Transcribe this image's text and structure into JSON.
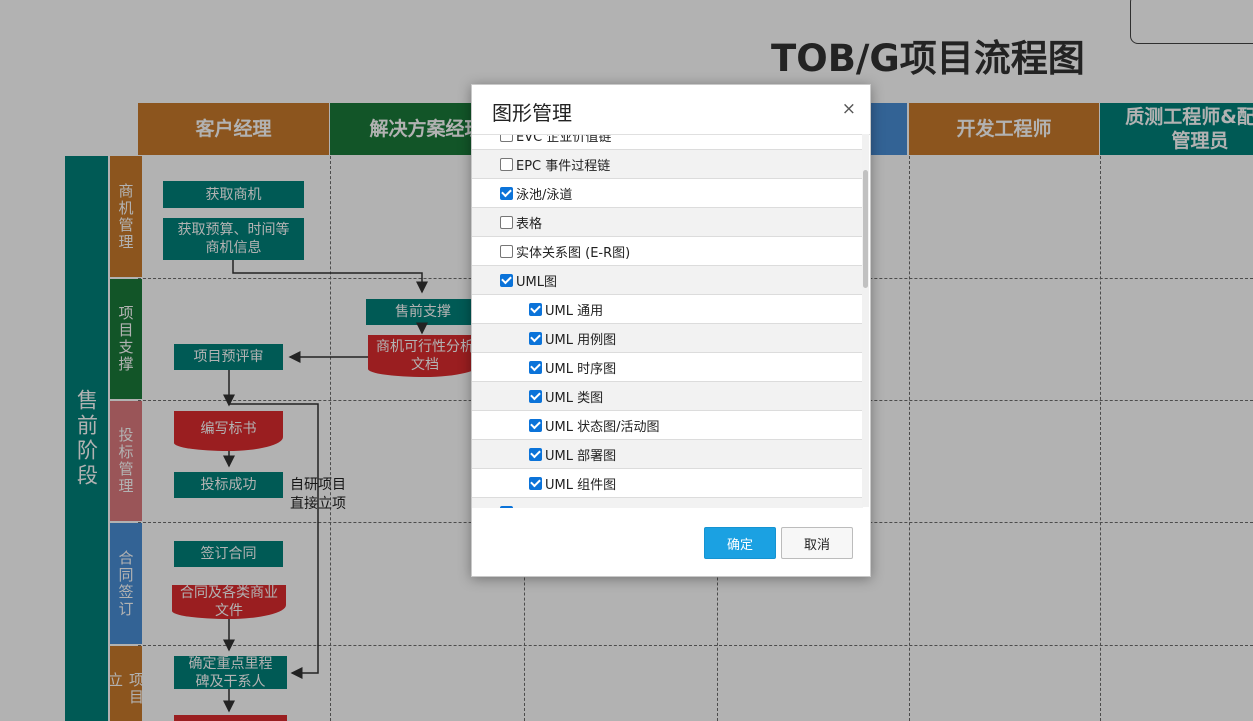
{
  "diagram": {
    "title": "TOB/G项目流程图",
    "lanes": [
      "客户经理",
      "解决方案经理",
      "",
      "开发工程师",
      "质测工程师&配置\n管理员"
    ],
    "stage": "售前阶段",
    "sub_lanes": [
      "商机管理",
      "项目支撑",
      "投标管理",
      "合同签订",
      "项目立"
    ],
    "boxes": {
      "get_opportunity": "获取商机",
      "get_budget_info": "获取预算、时间等\n商机信息",
      "presales_support": "售前支撑",
      "feasibility_doc": "商机可行性分析\n文档",
      "project_review": "项目预评审",
      "write_tender": "编写标书",
      "bid_success": "投标成功",
      "sign_contract": "签订合同",
      "contract_docs": "合同及各类商业\n文件",
      "confirm_milestones": "确定重点里程\n碑及干系人"
    },
    "note": "自研项目\n直接立项",
    "colors": {
      "orange": "#c97a2b",
      "green": "#1b7a3a",
      "blue": "#4a8fd6",
      "teal": "#00827a",
      "red": "#dd2b2f",
      "sub_lane_bid": "#dd7a7e",
      "sub_lane_contract": "#4a8fd6"
    }
  },
  "dialog": {
    "title": "图形管理",
    "close": "×",
    "items": [
      {
        "label": "EVC 企业价值链",
        "checked": false,
        "indent": 0
      },
      {
        "label": "EPC 事件过程链",
        "checked": false,
        "indent": 0
      },
      {
        "label": "泳池/泳道",
        "checked": true,
        "indent": 0
      },
      {
        "label": "表格",
        "checked": false,
        "indent": 0
      },
      {
        "label": "实体关系图 (E-R图)",
        "checked": false,
        "indent": 0
      },
      {
        "label": "UML图",
        "checked": true,
        "indent": 0
      },
      {
        "label": "UML 通用",
        "checked": true,
        "indent": 1
      },
      {
        "label": "UML 用例图",
        "checked": true,
        "indent": 1
      },
      {
        "label": "UML 时序图",
        "checked": true,
        "indent": 1
      },
      {
        "label": "UML 类图",
        "checked": true,
        "indent": 1
      },
      {
        "label": "UML 状态图/活动图",
        "checked": true,
        "indent": 1
      },
      {
        "label": "UML 部署图",
        "checked": true,
        "indent": 1
      },
      {
        "label": "UML 组件图",
        "checked": true,
        "indent": 1
      },
      {
        "label": "",
        "checked": true,
        "indent": 0
      }
    ],
    "confirm": "确定",
    "cancel": "取消"
  }
}
